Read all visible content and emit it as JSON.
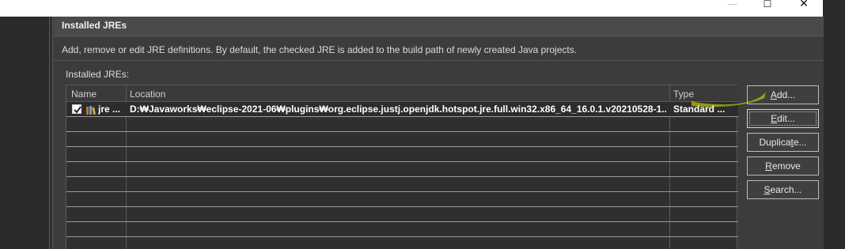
{
  "window": {
    "minimize_glyph": "—",
    "maximize_glyph": "☐",
    "close_glyph": "✕"
  },
  "dialog": {
    "section_title": "Installed JREs",
    "description": "Add, remove or edit JRE definitions. By default, the checked JRE is added to the build path of newly created Java projects.",
    "table_label": "Installed JREs:"
  },
  "table": {
    "columns": [
      "Name",
      "Location",
      "Type"
    ],
    "rows": [
      {
        "checked": true,
        "icon": "jre-library-icon",
        "name": "jre ...",
        "location": "D:₩Javaworks₩eclipse-2021-06₩plugins₩org.eclipse.justj.openjdk.hotspot.jre.full.win32.x86_64_16.0.1.v20210528-1...",
        "type": "Standard ..."
      }
    ]
  },
  "buttons": {
    "add": "Add...",
    "edit": "Edit...",
    "duplicate": "Duplicate...",
    "remove": "Remove",
    "search": "Search..."
  },
  "colors": {
    "highlight": "#e6f000",
    "dialog_bg": "#3c3c3c",
    "table_bg": "#2f2f2f"
  }
}
